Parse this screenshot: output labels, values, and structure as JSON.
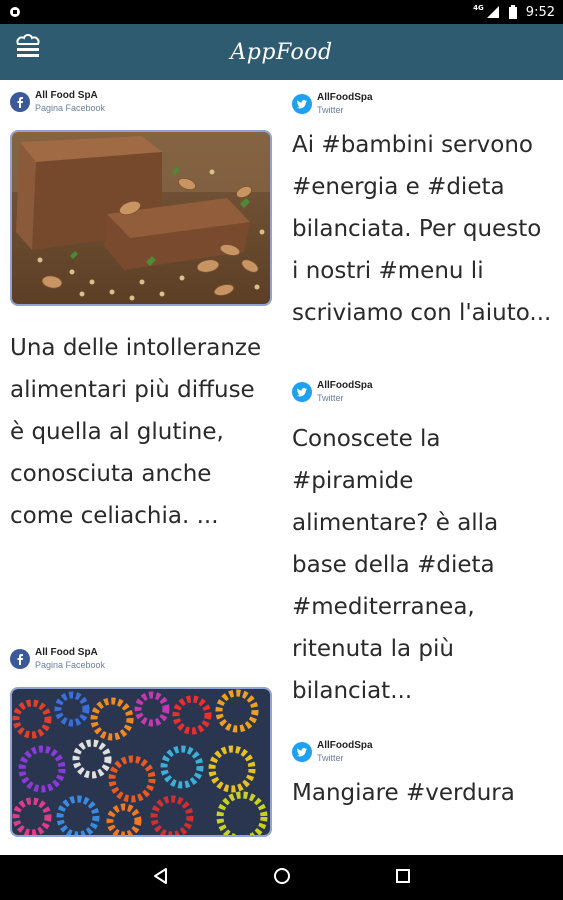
{
  "status_bar": {
    "time": "9:52",
    "network": "4G"
  },
  "app_bar": {
    "title": "AppFood",
    "menu_icon": "chef-hat-menu-icon",
    "color": "#2e5b6f"
  },
  "feed": {
    "left": [
      {
        "source": "All Food SpA",
        "source_type": "Pagina Facebook",
        "network": "facebook",
        "image": "bread-with-almonds",
        "text": "Una delle intolleranze alimentari più diffuse è quella al glutine, conosciuta anche come celiachia. ..."
      },
      {
        "source": "All Food SpA",
        "source_type": "Pagina Facebook",
        "network": "facebook",
        "image": "colorful-gears",
        "text": ""
      }
    ],
    "right": [
      {
        "source": "AllFoodSpa",
        "source_type": "Twitter",
        "network": "twitter",
        "text": "Ai #bambini servono #energia e #dieta bilanciata. Per questo i nostri #menu li scriviamo con l'aiuto..."
      },
      {
        "source": "AllFoodSpa",
        "source_type": "Twitter",
        "network": "twitter",
        "text": "Conoscete la #piramide alimentare? è alla base della #dieta #mediterranea, ritenuta la più bilanciat..."
      },
      {
        "source": "AllFoodSpa",
        "source_type": "Twitter",
        "network": "twitter",
        "text": "Mangiare #verdura"
      }
    ]
  },
  "nav_bar": {
    "back_icon": "back-icon",
    "home_icon": "home-icon",
    "recents_icon": "recents-icon"
  }
}
